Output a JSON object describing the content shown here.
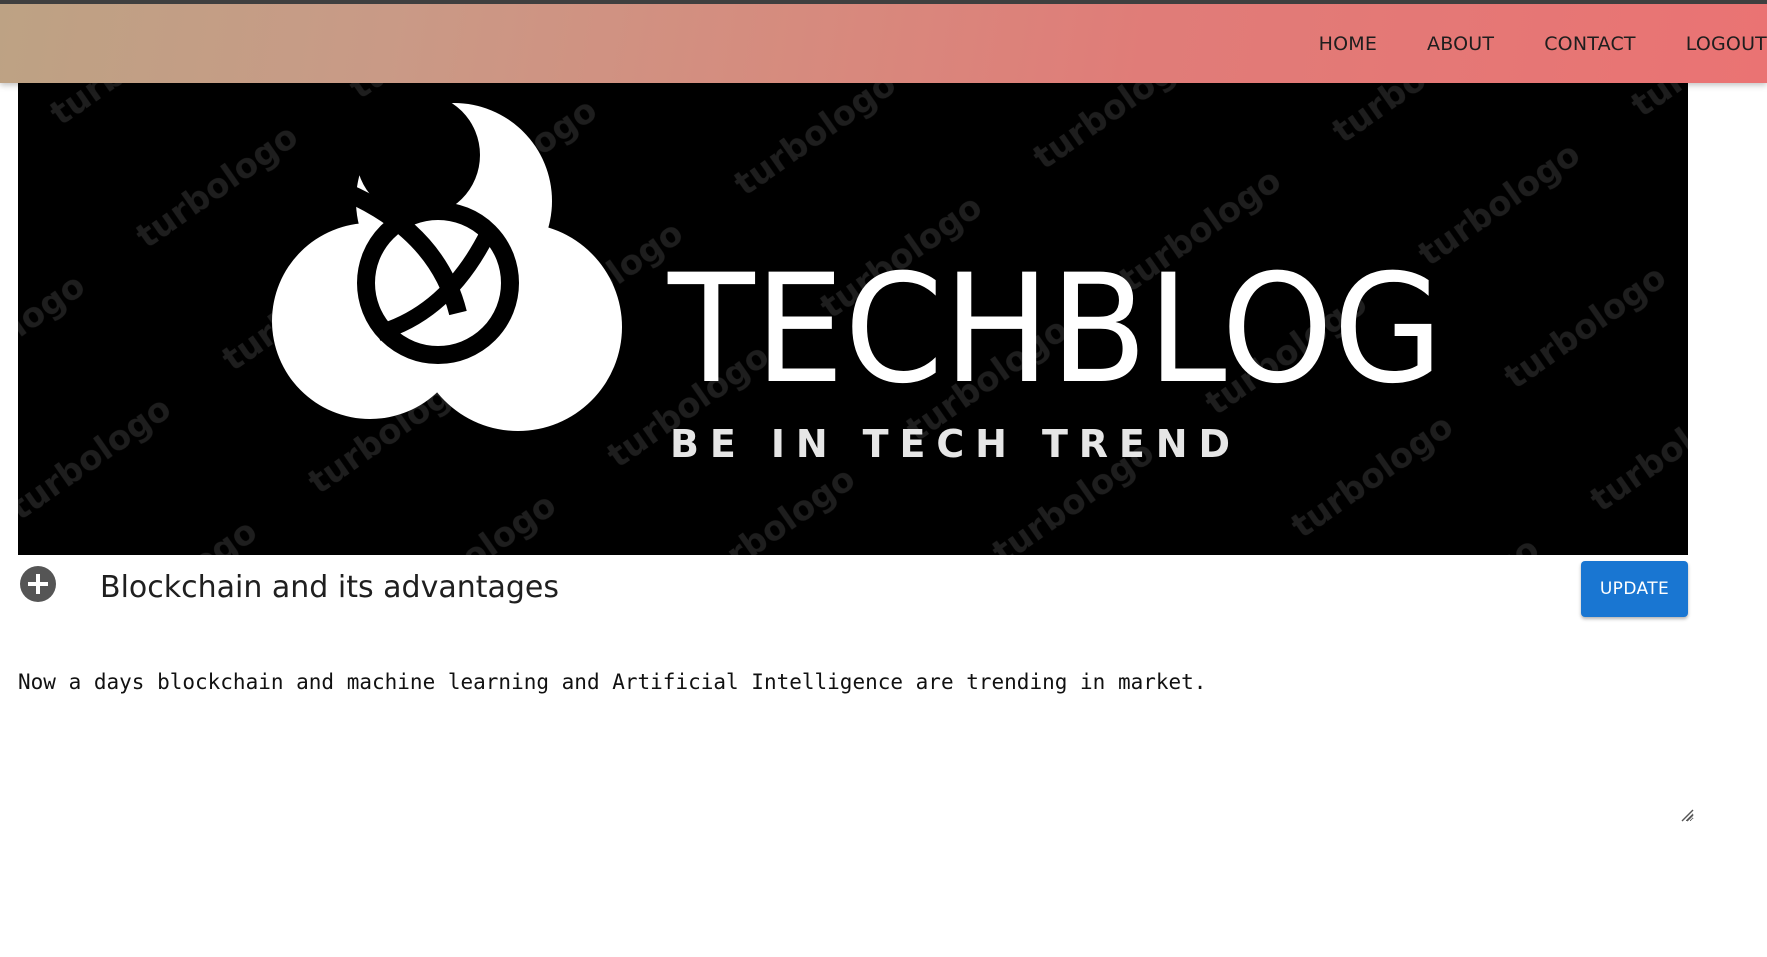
{
  "nav": {
    "items": [
      {
        "label": "HOME"
      },
      {
        "label": "ABOUT"
      },
      {
        "label": "CONTACT"
      },
      {
        "label": "LOGOUT"
      }
    ]
  },
  "banner": {
    "brand": "TECHBLOG",
    "tagline": "BE IN TECH TREND",
    "watermark": "turbologo",
    "icon": "swirl-logo-icon"
  },
  "post": {
    "add_icon": "plus-circle-icon",
    "title": "Blockchain and its advantages",
    "update_label": "UPDATE",
    "content": "Now a days blockchain and machine learning and Artificial Intelligence are trending in market."
  },
  "colors": {
    "nav_gradient_start": "#bda284",
    "nav_gradient_end": "#ea7373",
    "update_button": "#1976d2",
    "banner_bg": "#000000"
  }
}
